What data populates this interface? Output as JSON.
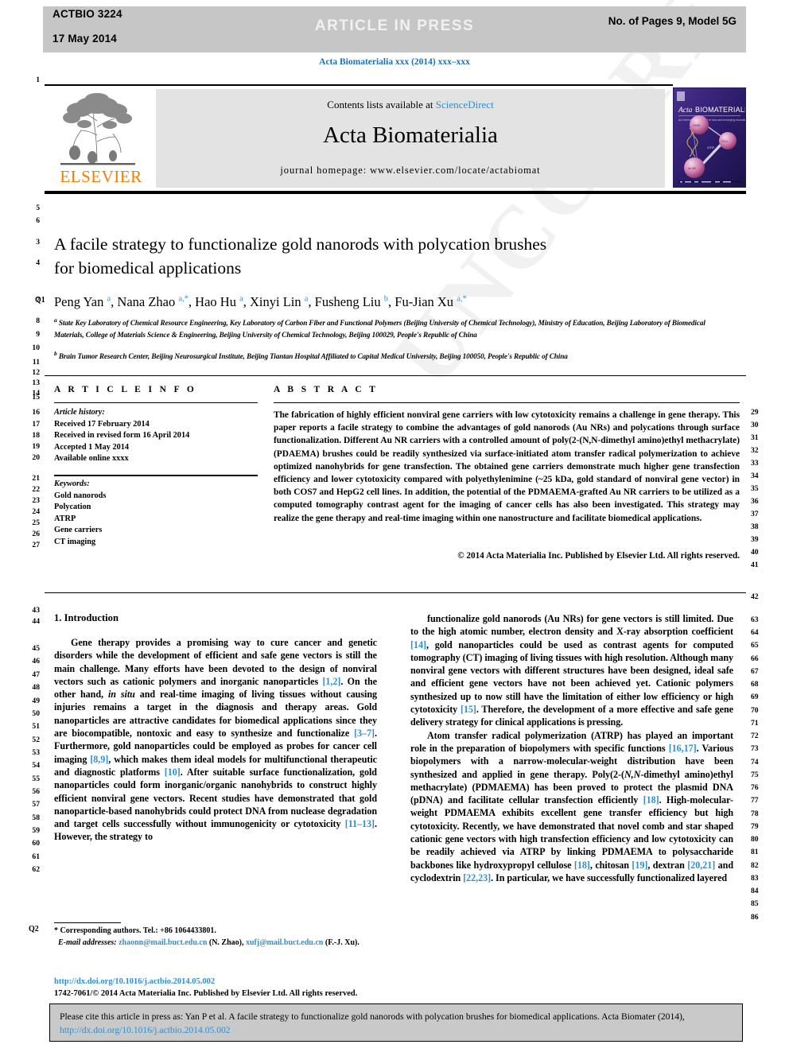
{
  "banner": {
    "code": "ACTBIO 3224",
    "date": "17 May 2014",
    "center": "ARTICLE IN PRESS",
    "right": "No. of Pages 9, Model 5G"
  },
  "running_head": "Acta Biomaterialia xxx (2014) xxx–xxx",
  "masthead": {
    "contents_prefix": "Contents lists available at ",
    "contents_link": "ScienceDirect",
    "journal_name": "Acta Biomaterialia",
    "homepage": "journal homepage: www.elsevier.com/locate/actabiomat",
    "publisher": "ELSEVIER",
    "cover_title": "Acta BIOMATERIALIA",
    "cover_subtitle": "An international journal of new & emerging biomaterials science"
  },
  "article": {
    "title_line1": "A facile strategy to functionalize gold nanorods with polycation brushes",
    "title_line2": "for biomedical applications",
    "authors_html": "Peng Yan <sup>a</sup>, Nana Zhao <sup>a,*</sup>, Hao Hu <sup>a</sup>, Xinyi Lin <sup>a</sup>, Fusheng Liu <sup>b</sup>, Fu-Jian Xu <sup>a,*</sup>",
    "affiliation_a": "State Key Laboratory of Chemical Resource Engineering, Key Laboratory of Carbon Fiber and Functional Polymers (Beijing University of Chemical Technology), Ministry of Education, Beijing Laboratory of Biomedical Materials, College of Materials Science & Engineering, Beijing University of Chemical Technology, Beijing 100029, People's Republic of China",
    "affiliation_b": "Brain Tumor Research Center, Beijing Neurosurgical Institute, Beijing Tiantan Hospital Affiliated to Capital Medical University, Beijing 100050, People's Republic of China"
  },
  "info": {
    "heading": "A R T I C L E   I N F O",
    "history_label": "Article history:",
    "history": [
      "Received 17 February 2014",
      "Received in revised form 16 April 2014",
      "Accepted 1 May 2014",
      "Available online xxxx"
    ],
    "keywords_label": "Keywords:",
    "keywords": [
      "Gold nanorods",
      "Polycation",
      "ATRP",
      "Gene carriers",
      "CT imaging"
    ]
  },
  "abstract": {
    "heading": "A B S T R A C T",
    "text": "The fabrication of highly efficient nonviral gene carriers with low cytotoxicity remains a challenge in gene therapy. This paper reports a facile strategy to combine the advantages of gold nanorods (Au NRs) and polycations through surface functionalization. Different Au NR carriers with a controlled amount of poly(2-(N,N-dimethyl amino)ethyl methacrylate) (PDAEMA) brushes could be readily synthesized via surface-initiated atom transfer radical polymerization to achieve optimized nanohybrids for gene transfection. The obtained gene carriers demonstrate much higher gene transfection efficiency and lower cytotoxicity compared with polyethylenimine (~25 kDa, gold standard of nonviral gene vector) in both COS7 and HepG2 cell lines. In addition, the potential of the PDMAEMA-grafted Au NR carriers to be utilized as a computed tomography contrast agent for the imaging of cancer cells has also been investigated. This strategy may realize the gene therapy and real-time imaging within one nanostructure and facilitate biomedical applications.",
    "copyright": "© 2014 Acta Materialia Inc. Published by Elsevier Ltd. All rights reserved."
  },
  "body": {
    "section_heading": "1. Introduction",
    "left_paragraph_1": "Gene therapy provides a promising way to cure cancer and genetic disorders while the development of efficient and safe gene vectors is still the main challenge. Many efforts have been devoted to the design of nonviral vectors such as cationic polymers and inorganic nanoparticles [1,2]. On the other hand, in situ and real-time imaging of living tissues without causing injuries remains a target in the diagnosis and therapy areas. Gold nanoparticles are attractive candidates for biomedical applications since they are biocompatible, nontoxic and easy to synthesize and functionalize [3–7]. Furthermore, gold nanoparticles could be employed as probes for cancer cell imaging [8,9], which makes them ideal models for multifunctional therapeutic and diagnostic platforms [10]. After suitable surface functionalization, gold nanoparticles could form inorganic/organic nanohybrids to construct highly efficient nonviral gene vectors. Recent studies have demonstrated that gold nanoparticle-based nanohybrids could protect DNA from nuclease degradation and target cells successfully without immunogenicity or cytotoxicity [11–13]. However, the strategy to",
    "right_paragraph_1": "functionalize gold nanorods (Au NRs) for gene vectors is still limited. Due to the high atomic number, electron density and X-ray absorption coefficient [14], gold nanoparticles could be used as contrast agents for computed tomography (CT) imaging of living tissues with high resolution. Although many nonviral gene vectors with different structures have been designed, ideal safe and efficient gene vectors have not been achieved yet. Cationic polymers synthesized up to now still have the limitation of either low efficiency or high cytotoxicity [15]. Therefore, the development of a more effective and safe gene delivery strategy for clinical applications is pressing.",
    "right_paragraph_2": "Atom transfer radical polymerization (ATRP) has played an important role in the preparation of biopolymers with specific functions [16,17]. Various biopolymers with a narrow-molecular-weight distribution have been synthesized and applied in gene therapy. Poly(2-(N,N-dimethyl amino)ethyl methacrylate) (PDMAEMA) has been proved to protect the plasmid DNA (pDNA) and facilitate cellular transfection efficiently [18]. High-molecular-weight PDMAEMA exhibits excellent gene transfer efficiency but high cytotoxicity. Recently, we have demonstrated that novel comb and star shaped cationic gene vectors with high transfection efficiency and low cytotoxicity can be readily achieved via ATRP by linking PDMAEMA to polysaccharide backbones like hydroxypropyl cellulose [18], chitosan [19], dextran [20,21] and cyclodextrin [22,23]. In particular, we have successfully functionalized layered"
  },
  "footnote": {
    "corresponding": "* Corresponding authors. Tel.: +86 1064433801.",
    "email_label": "E-mail addresses:",
    "email_1": "zhaonn@mail.buct.edu.cn",
    "email_1_who": "(N. Zhao),",
    "email_2": "xufj@mail.buct.edu.cn",
    "email_2_who": "(F.-J. Xu).",
    "q2_tag": "Q2",
    "q1_tag": "Q1"
  },
  "doi": {
    "url": "http://dx.doi.org/10.1016/j.actbio.2014.05.002",
    "issn_line": "1742-7061/© 2014 Acta Materialia Inc. Published by Elsevier Ltd. All rights reserved."
  },
  "cite_box": {
    "text_1": "Please cite this article in press as: Yan P et al. A facile strategy to functionalize gold nanorods with polycation brushes for biomedical applications. Acta Biomater (2014), ",
    "link": "http://dx.doi.org/10.1016/j.actbio.2014.05.002"
  },
  "watermark": "UNCORRECTED PROOF",
  "line_numbers": {
    "pre_title": [
      "1",
      "5",
      "6",
      "3",
      "4",
      "7"
    ],
    "affiliations": [
      "8",
      "9",
      "10",
      "11"
    ],
    "info_block": [
      "12",
      "13",
      "14",
      "15",
      "16",
      "17",
      "18",
      "19",
      "20",
      "21",
      "22",
      "23",
      "24",
      "25",
      "26",
      "27"
    ],
    "abstract_block": [
      "29",
      "30",
      "31",
      "32",
      "33",
      "34",
      "35",
      "36",
      "37",
      "38",
      "39",
      "40",
      "41",
      "42"
    ],
    "left_col": [
      "43",
      "44",
      "45",
      "46",
      "47",
      "48",
      "49",
      "50",
      "51",
      "52",
      "53",
      "54",
      "55",
      "56",
      "57",
      "58",
      "59",
      "60",
      "61",
      "62"
    ],
    "right_col": [
      "63",
      "64",
      "65",
      "66",
      "67",
      "68",
      "69",
      "70",
      "71",
      "72",
      "73",
      "74",
      "75",
      "76",
      "77",
      "78",
      "79",
      "80",
      "81",
      "82",
      "83",
      "84",
      "85",
      "86"
    ]
  },
  "colors": {
    "link": "#2f8fd0",
    "banner_bg": "#c6c6c6",
    "panel_bg": "#e3e3e3",
    "elsevier_orange": "#f08000",
    "cover_bg": "#33206e"
  }
}
